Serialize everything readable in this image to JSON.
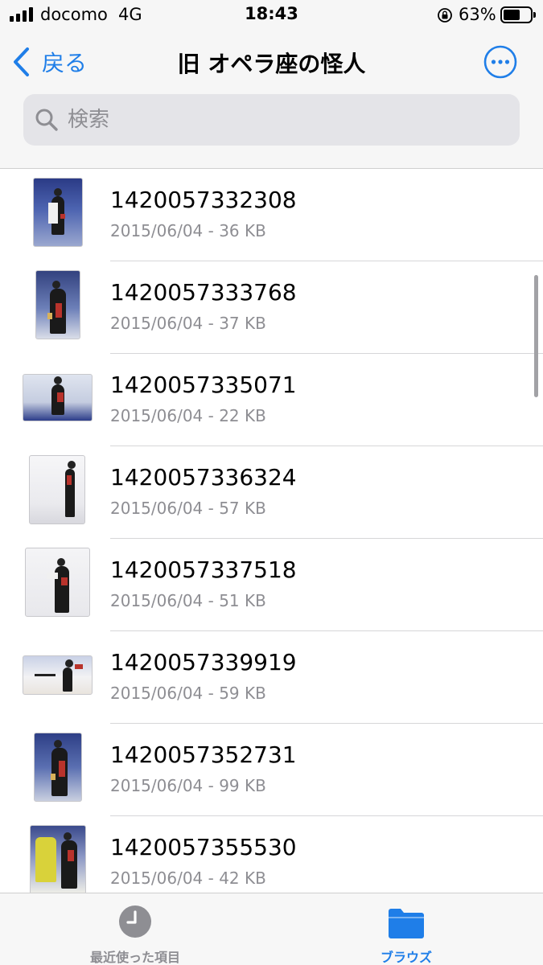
{
  "status_bar": {
    "carrier": "docomo",
    "network": "4G",
    "time": "18:43",
    "battery_percent": "63%",
    "battery_level": 0.63,
    "signal_bars": 4
  },
  "nav": {
    "back_label": "戻る",
    "title": "旧 オペラ座の怪人",
    "more_icon": "ellipsis-circle-icon"
  },
  "search": {
    "placeholder": "検索",
    "value": ""
  },
  "colors": {
    "accent": "#1f7ee8",
    "secondary_text": "#8e8e93",
    "divider": "#d6d6d8"
  },
  "files": [
    {
      "name": "1420057332308",
      "meta": "2015/06/04 - 36 KB",
      "thumb_icon": "skater-photo-thumbnail"
    },
    {
      "name": "1420057333768",
      "meta": "2015/06/04 - 37 KB",
      "thumb_icon": "skater-photo-thumbnail"
    },
    {
      "name": "1420057335071",
      "meta": "2015/06/04 - 22 KB",
      "thumb_icon": "skater-photo-thumbnail"
    },
    {
      "name": "1420057336324",
      "meta": "2015/06/04 - 57 KB",
      "thumb_icon": "skater-photo-thumbnail"
    },
    {
      "name": "1420057337518",
      "meta": "2015/06/04 - 51 KB",
      "thumb_icon": "skater-photo-thumbnail"
    },
    {
      "name": "1420057339919",
      "meta": "2015/06/04 - 59 KB",
      "thumb_icon": "skater-photo-thumbnail"
    },
    {
      "name": "1420057352731",
      "meta": "2015/06/04 - 99 KB",
      "thumb_icon": "skater-photo-thumbnail"
    },
    {
      "name": "1420057355530",
      "meta": "2015/06/04 - 42 KB",
      "thumb_icon": "skater-photo-thumbnail"
    }
  ],
  "tab_bar": {
    "recent_label": "最近使った項目",
    "recent_icon": "clock-icon",
    "browse_label": "ブラウズ",
    "browse_icon": "folder-icon",
    "selected": "browse"
  }
}
